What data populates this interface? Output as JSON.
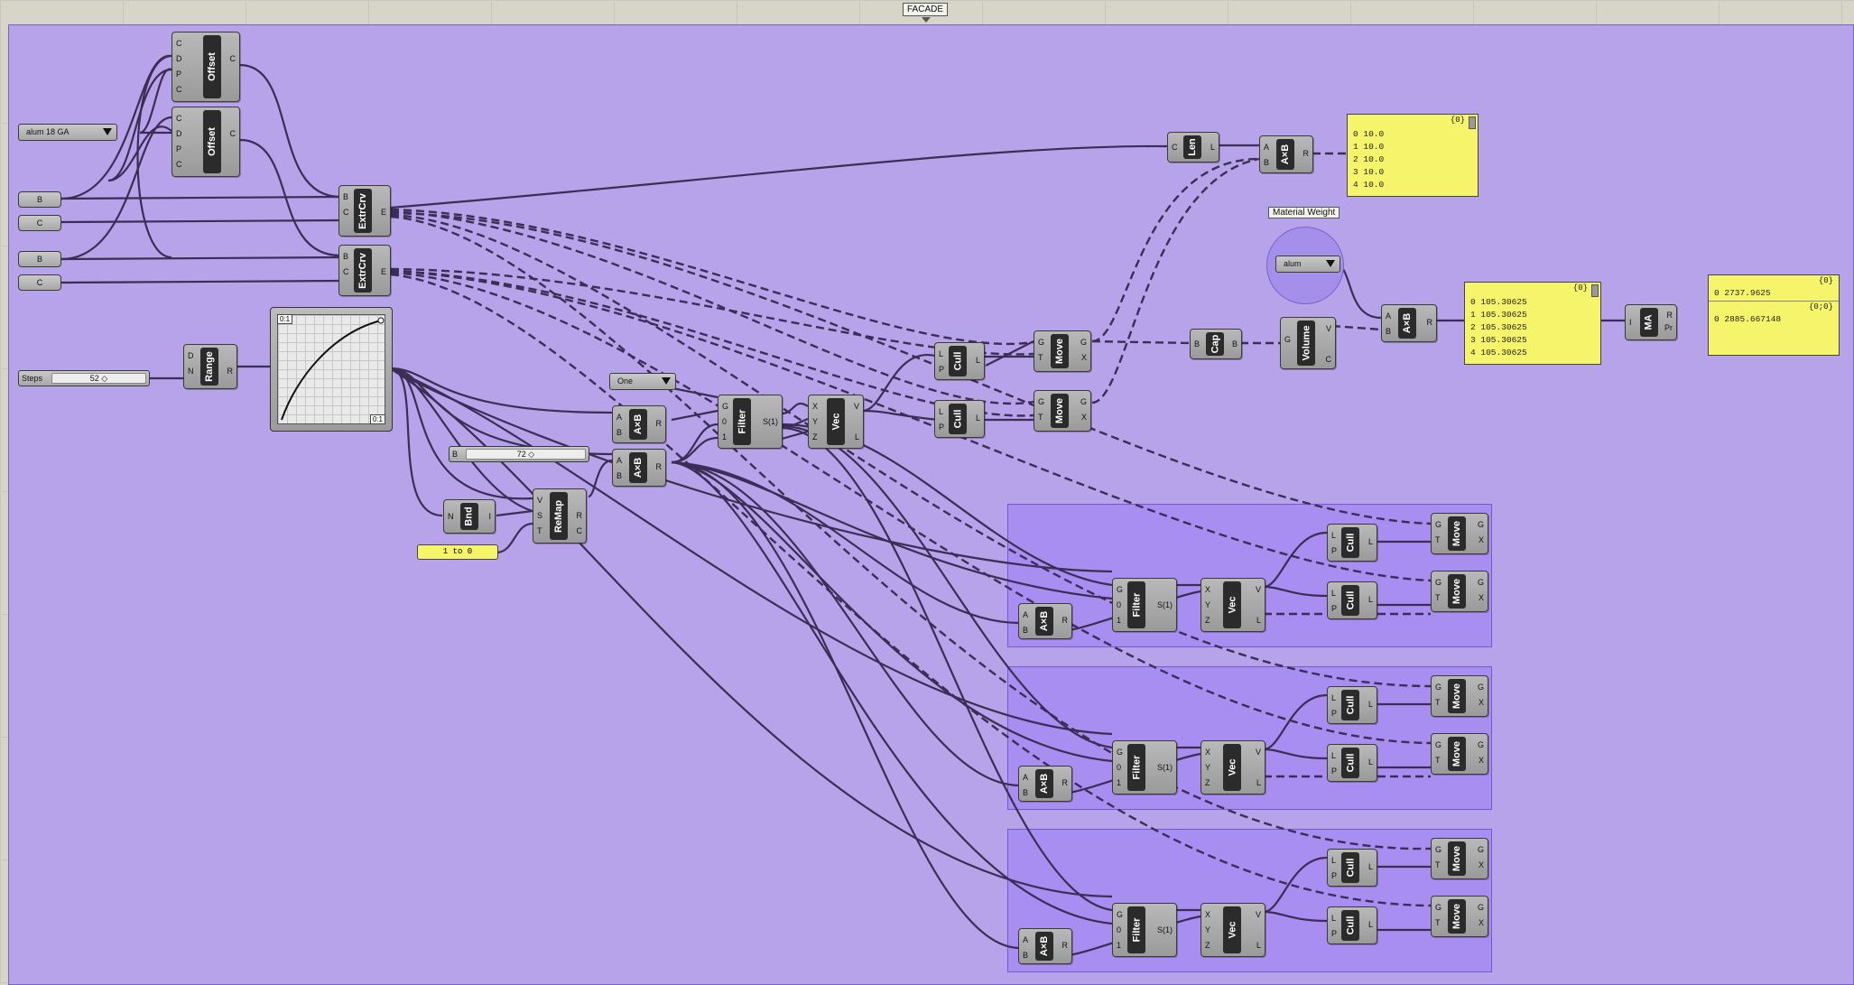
{
  "group_title": "FACADE",
  "material_weight_label": "Material Weight",
  "material_selector": "alum",
  "gauge_selector": "alum 18 GA",
  "one_selector": "One",
  "steps_slider": {
    "label": "Steps",
    "value": "52 ◇"
  },
  "b_slider": {
    "label": "B",
    "value": "72 ◇"
  },
  "remap_domain": "1 to 0",
  "graph": {
    "tl": "0:1",
    "br": "0:1"
  },
  "params": {
    "b": "B",
    "c": "C"
  },
  "components": {
    "offset": "Offset",
    "extrcrv": "ExtrCrv",
    "range": "Range",
    "bnd": "Bnd",
    "remap": "ReMap",
    "axb": "A×B",
    "filter": "Filter",
    "vec": "Vec",
    "cull": "Cull",
    "move": "Move",
    "len": "Len",
    "cap": "Cap",
    "volume": "Volume",
    "ma": "MA"
  },
  "len_panel": {
    "header": "{0}",
    "rows": [
      "0 10.0",
      "1 10.0",
      "2 10.0",
      "3 10.0",
      "4 10.0"
    ]
  },
  "volume_panel": {
    "header": "{0}",
    "rows": [
      "0 105.30625",
      "1 105.30625",
      "2 105.30625",
      "3 105.30625",
      "4 105.30625"
    ]
  },
  "result_panel": {
    "header1": "{0}",
    "row1": "0 2737.9625",
    "header2": "{0;0}",
    "row2": "0 2885.667148"
  }
}
